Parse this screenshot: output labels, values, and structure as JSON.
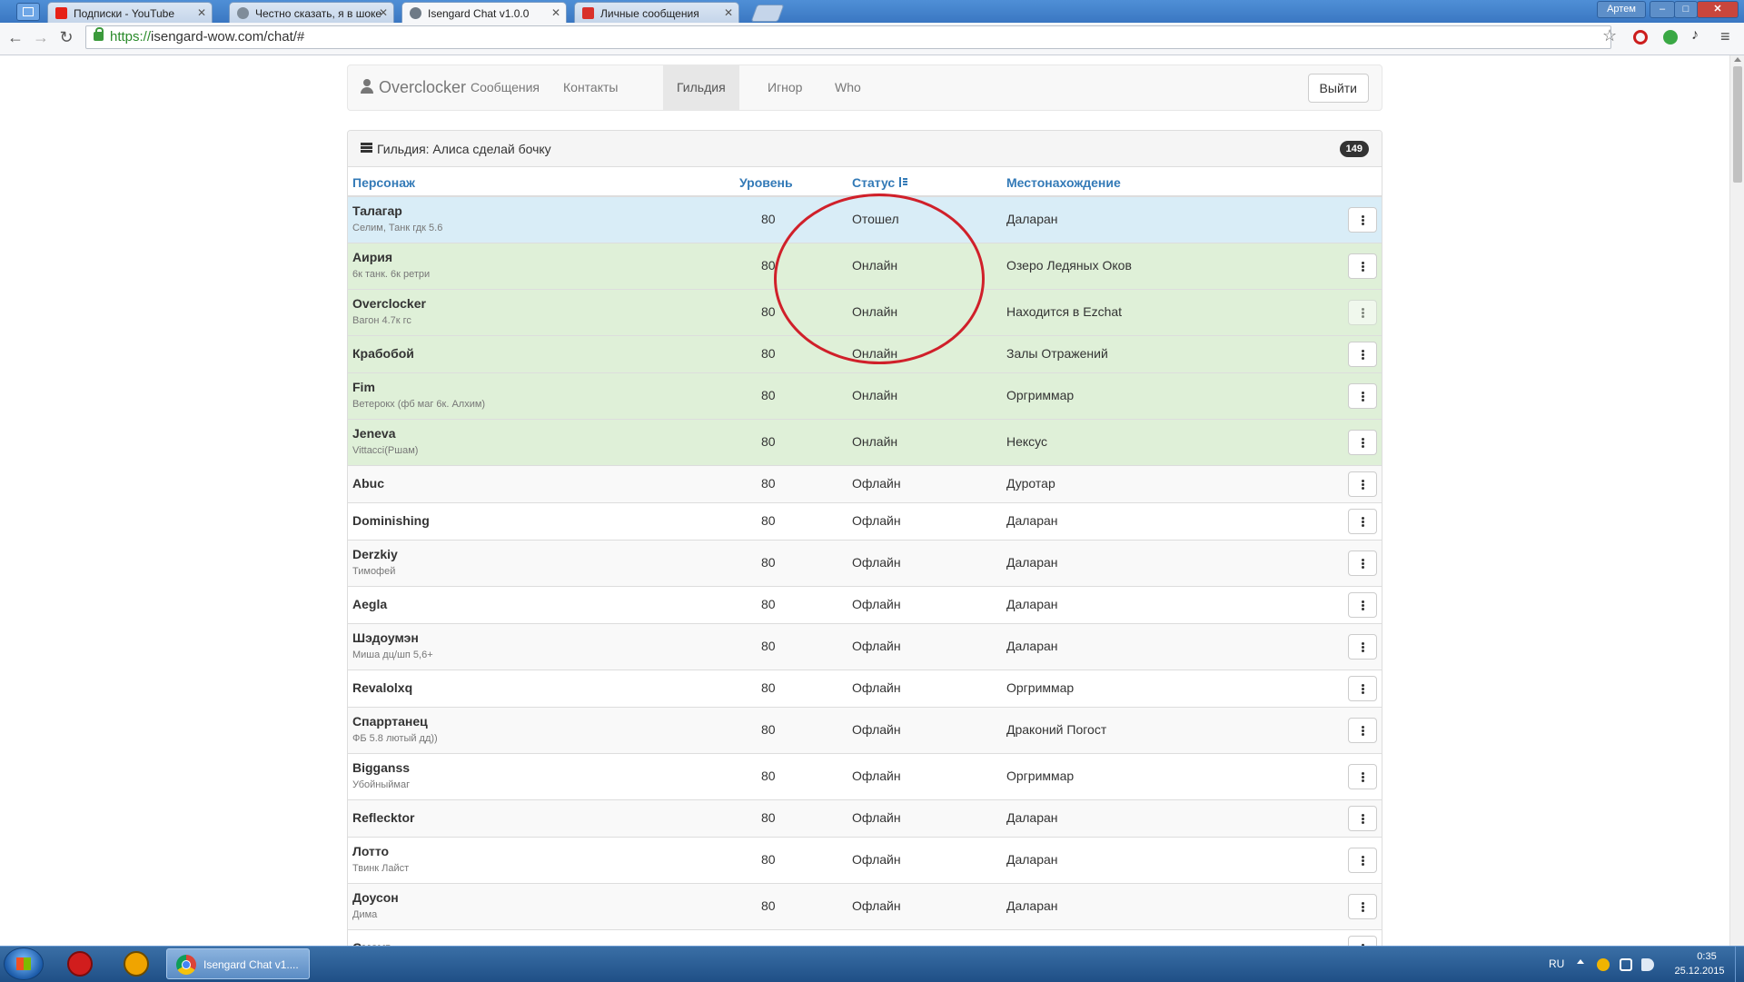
{
  "browser": {
    "tabs": [
      {
        "label": "Подписки - YouTube",
        "favicon_color": "#e62117",
        "active": false
      },
      {
        "label": "Честно сказать, я в шоке",
        "favicon_color": "#7f8c99",
        "active": false
      },
      {
        "label": "Isengard Chat v1.0.0",
        "favicon_color": "#6e7a86",
        "active": true
      },
      {
        "label": "Личные сообщения",
        "favicon_color": "#d9302a",
        "active": false
      }
    ],
    "user_chip": "Артем",
    "url_scheme": "https://",
    "url_rest": "isengard-wow.com/chat/#"
  },
  "navbar": {
    "brand": "Overclocker",
    "items": [
      "Сообщения",
      "Контакты",
      "Гильдия",
      "Игнор",
      "Who"
    ],
    "active_item": "Гильдия",
    "logout": "Выйти"
  },
  "panel": {
    "title": "Гильдия: Алиса сделай бочку",
    "count": "149",
    "columns": {
      "name": "Персонаж",
      "level": "Уровень",
      "status": "Статус",
      "location": "Местонахождение"
    },
    "rows": [
      {
        "name": "Талагар",
        "note": "Селим, Танк гдк 5.6",
        "level": "80",
        "status": "Отошел",
        "location": "Даларан",
        "state": "away"
      },
      {
        "name": "Аирия",
        "note": "6к танк. 6к ретри",
        "level": "80",
        "status": "Онлайн",
        "location": "Озеро Ледяных Оков",
        "state": "online"
      },
      {
        "name": "Overclocker",
        "note": "Вагон 4.7к гс",
        "level": "80",
        "status": "Онлайн",
        "location": "Находится в Ezchat",
        "state": "online",
        "dim": true
      },
      {
        "name": "Крабобой",
        "note": "",
        "level": "80",
        "status": "Онлайн",
        "location": "Залы Отражений",
        "state": "online"
      },
      {
        "name": "Fim",
        "note": "Ветерокх (фб маг 6к. Алхим)",
        "level": "80",
        "status": "Онлайн",
        "location": "Оргриммар",
        "state": "online"
      },
      {
        "name": "Jeneva",
        "note": "Vittacci(Ршам)",
        "level": "80",
        "status": "Онлайн",
        "location": "Нексус",
        "state": "online"
      },
      {
        "name": "Abuc",
        "note": "",
        "level": "80",
        "status": "Офлайн",
        "location": "Дуротар",
        "state": "offline"
      },
      {
        "name": "Dominishing",
        "note": "",
        "level": "80",
        "status": "Офлайн",
        "location": "Даларан",
        "state": "offline"
      },
      {
        "name": "Derzkiy",
        "note": "Тимофей",
        "level": "80",
        "status": "Офлайн",
        "location": "Даларан",
        "state": "offline"
      },
      {
        "name": "Aegla",
        "note": "",
        "level": "80",
        "status": "Офлайн",
        "location": "Даларан",
        "state": "offline"
      },
      {
        "name": "Шэдоумэн",
        "note": "Миша дц/шп 5,6+",
        "level": "80",
        "status": "Офлайн",
        "location": "Даларан",
        "state": "offline"
      },
      {
        "name": "Revalolxq",
        "note": "",
        "level": "80",
        "status": "Офлайн",
        "location": "Оргриммар",
        "state": "offline"
      },
      {
        "name": "Спарртанец",
        "note": "ФБ 5.8 лютый дд))",
        "level": "80",
        "status": "Офлайн",
        "location": "Драконий Погост",
        "state": "offline"
      },
      {
        "name": "Bigganss",
        "note": "Убойныймаг",
        "level": "80",
        "status": "Офлайн",
        "location": "Оргриммар",
        "state": "offline"
      },
      {
        "name": "Reflecktor",
        "note": "",
        "level": "80",
        "status": "Офлайн",
        "location": "Даларан",
        "state": "offline"
      },
      {
        "name": "Лотто",
        "note": "Твинк Лайст",
        "level": "80",
        "status": "Офлайн",
        "location": "Даларан",
        "state": "offline"
      },
      {
        "name": "Доусон",
        "note": "Дима",
        "level": "80",
        "status": "Офлайн",
        "location": "Даларан",
        "state": "offline"
      },
      {
        "name": "Смауг",
        "note": "",
        "level": "",
        "status": "",
        "location": "",
        "state": "offline"
      }
    ]
  },
  "taskbar": {
    "chrome_task": "Isengard Chat v1....",
    "lang": "RU",
    "time": "0:35",
    "date": "25.12.2015"
  },
  "colors": {
    "away_row": "#d9edf7",
    "online_row": "#dff0d8",
    "link": "#337ab7",
    "annotation": "#d0202a"
  }
}
